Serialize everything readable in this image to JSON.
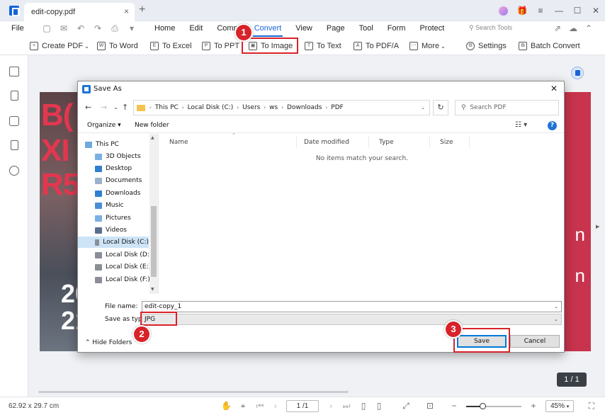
{
  "titlebar": {
    "tab_label": "edit-copy.pdf",
    "tab_close": "×",
    "new_tab": "+",
    "window_buttons": [
      "—",
      "☐",
      "✕"
    ]
  },
  "menubar": {
    "file_label": "File",
    "tabs": [
      "Home",
      "Edit",
      "Comm",
      "Convert",
      "View",
      "Page",
      "Tool",
      "Form",
      "Protect"
    ],
    "active_tab": "Convert",
    "search_tools": "Search Tools"
  },
  "toolbar": {
    "create_pdf": "Create PDF",
    "to_word": "To Word",
    "to_excel": "To Excel",
    "to_ppt": "To PPT",
    "to_image": "To Image",
    "to_text": "To Text",
    "to_pdfa": "To PDF/A",
    "more": "More",
    "settings": "Settings",
    "batch_convert": "Batch Convert"
  },
  "document": {
    "big_text": [
      "B",
      "X",
      "R5"
    ],
    "big_text_lines": [
      "B(",
      "XI",
      "R5"
    ],
    "date_lines": [
      "20",
      "21"
    ],
    "right_chars": [
      "n",
      "n"
    ],
    "page_indicator": "1 / 1"
  },
  "dialog": {
    "title": "Save As",
    "close": "✕",
    "breadcrumb": [
      "This PC",
      "Local Disk (C:)",
      "Users",
      "ws",
      "Downloads",
      "PDF"
    ],
    "search_placeholder": "Search PDF",
    "organize": "Organize ▾",
    "new_folder": "New folder",
    "help": "?",
    "nav_items": [
      {
        "label": "This PC",
        "color": "#6fa8dc"
      },
      {
        "label": "3D Objects",
        "color": "#7ab0e0"
      },
      {
        "label": "Desktop",
        "color": "#2f7fd1"
      },
      {
        "label": "Documents",
        "color": "#9ab3cc"
      },
      {
        "label": "Downloads",
        "color": "#2f7fd1"
      },
      {
        "label": "Music",
        "color": "#4a8fd4"
      },
      {
        "label": "Pictures",
        "color": "#7ab0e0"
      },
      {
        "label": "Videos",
        "color": "#5b6f8c"
      },
      {
        "label": "Local Disk (C:)",
        "color": "#8a8f96"
      },
      {
        "label": "Local Disk (D:)",
        "color": "#8a8f96"
      },
      {
        "label": "Local Disk (E:)",
        "color": "#8a8f96"
      },
      {
        "label": "Local Disk (F:)",
        "color": "#8a8f96"
      }
    ],
    "selected_nav": "Local Disk (C:)",
    "columns": [
      "Name",
      "Date modified",
      "Type",
      "Size"
    ],
    "empty_message": "No items match your search.",
    "file_name_label": "File name:",
    "file_name_value": "edit-copy_1",
    "save_type_label": "Save as type:",
    "save_type_value": "JPG",
    "hide_folders": "Hide Folders",
    "save_button": "Save",
    "cancel_button": "Cancel"
  },
  "annotations": {
    "step1": "1",
    "step2": "2",
    "step3": "3",
    "highlight_color": "#d8232a"
  },
  "statusbar": {
    "dimensions": "62.92 x 29.7 cm",
    "page_value": "1 /1",
    "zoom_value": "45%",
    "zoom_fraction": 0.3
  },
  "colors": {
    "accent": "#1565d8",
    "page_background": "#c8334d"
  }
}
